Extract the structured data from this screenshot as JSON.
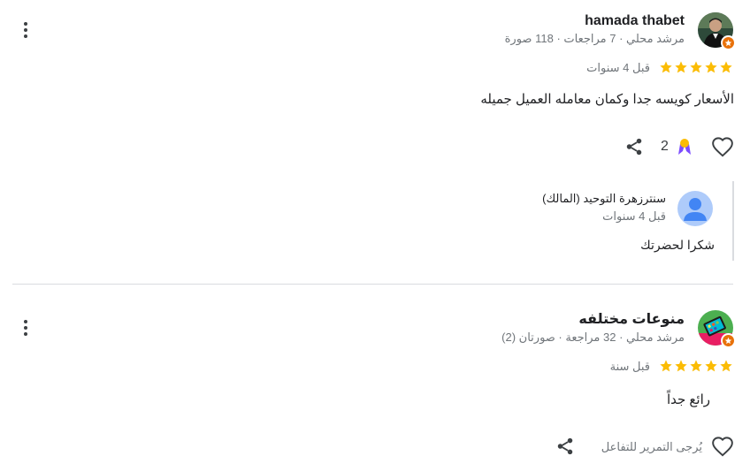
{
  "reviews": [
    {
      "name": "hamada thabet",
      "meta": "مرشد محلي · 7 مراجعات · 118 صورة",
      "rating": 5,
      "time": "قبل 4 سنوات",
      "text": "الأسعار كويسه جدا وكمان معامله العميل جميله",
      "like_count": "2",
      "owner_reply": {
        "name": "سنترزهرة التوحيد (المالك)",
        "time": "قبل 4 سنوات",
        "text": "شكرا لحضرتك"
      }
    },
    {
      "name": "منوعات مختلفه",
      "meta": "مرشد محلي · 32 مراجعة · صورتان (2)",
      "rating": 5,
      "time": "قبل سنة",
      "text": "رائع جداً",
      "hover_hint": "يُرجى التمرير للتفاعل"
    }
  ],
  "colors": {
    "star": "#fbbc04",
    "badge": "#e8710a",
    "muted": "#70757a",
    "divider": "#dadce0",
    "owner_avatar": "#aecbfa"
  },
  "icons": {
    "more": "more-vert-icon",
    "share": "share-icon",
    "like": "heart-outline-icon",
    "award": "award-ribbon-icon",
    "star": "star-icon",
    "local_guide": "local-guide-badge-icon"
  }
}
